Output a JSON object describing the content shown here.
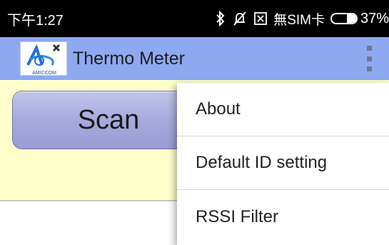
{
  "status_bar": {
    "time": "下午1:27",
    "sim_status": "無SIM卡",
    "battery": "37%",
    "battery_level": 0.37,
    "icons": [
      "bluetooth-icon",
      "muted-bell-icon",
      "sim-icon",
      "battery-icon"
    ]
  },
  "action_bar": {
    "title": "Thermo Meter",
    "logo_icon": "amiccom-logo-icon",
    "logo_text": "AMICCOM",
    "overflow_icon": "overflow-menu-icon",
    "background_color": "#8ea9f2"
  },
  "main": {
    "scan_label": "Scan",
    "panel_color": "#ffffcc"
  },
  "menu": {
    "items": [
      {
        "label": "About"
      },
      {
        "label": "Default ID setting"
      },
      {
        "label": "RSSI Filter"
      }
    ]
  }
}
